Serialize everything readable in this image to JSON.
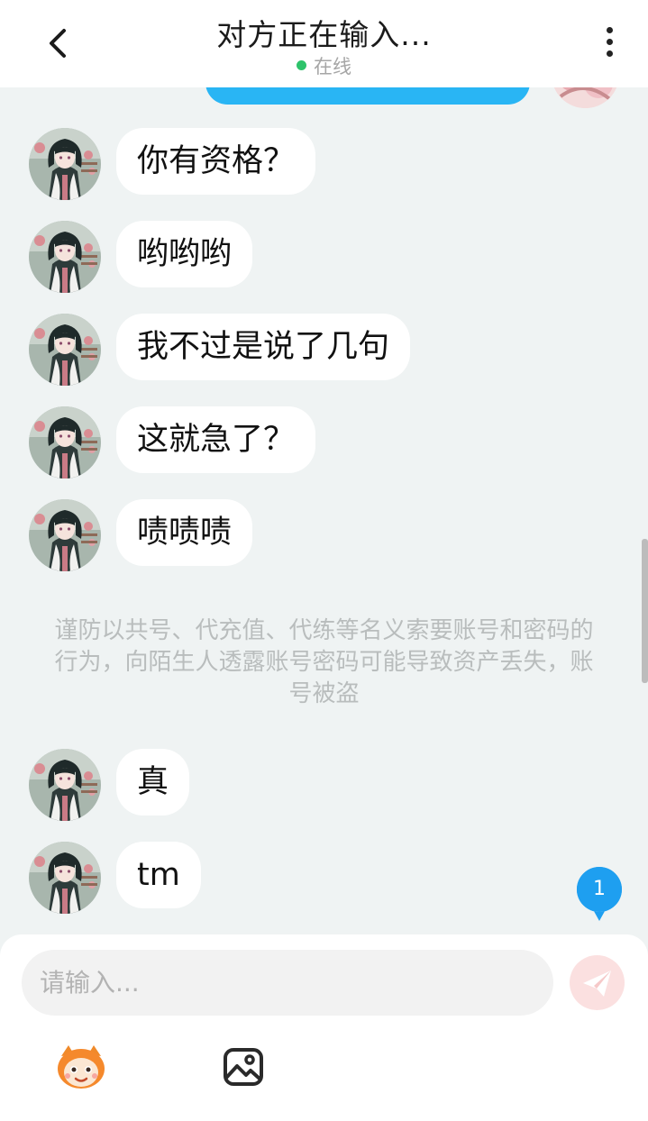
{
  "header": {
    "title": "对方正在输入...",
    "status": "在线",
    "icons": {
      "back": "chevron-left-icon",
      "more": "more-vertical-icon"
    },
    "status_color": "#2ec36b"
  },
  "messages": [
    {
      "text": "你有资格？"
    },
    {
      "text": "哟哟哟"
    },
    {
      "text": "我不过是说了几句"
    },
    {
      "text": "这就急了？"
    },
    {
      "text": "啧啧啧"
    },
    {
      "text": "真"
    },
    {
      "text": "tm"
    }
  ],
  "notice": "谨防以共号、代充值、代练等名义索要账号和密码的行为，向陌生人透露账号密码可能导致资产丢失，账号被盗",
  "unread_badge": "1",
  "composer": {
    "placeholder": "请输入...",
    "icons": {
      "send": "send-icon",
      "sticker": "sticker-mascot-icon",
      "image": "image-icon"
    }
  },
  "colors": {
    "accent": "#29b5f4",
    "background": "#eff3f3",
    "send_button": "#fbe0e0"
  }
}
